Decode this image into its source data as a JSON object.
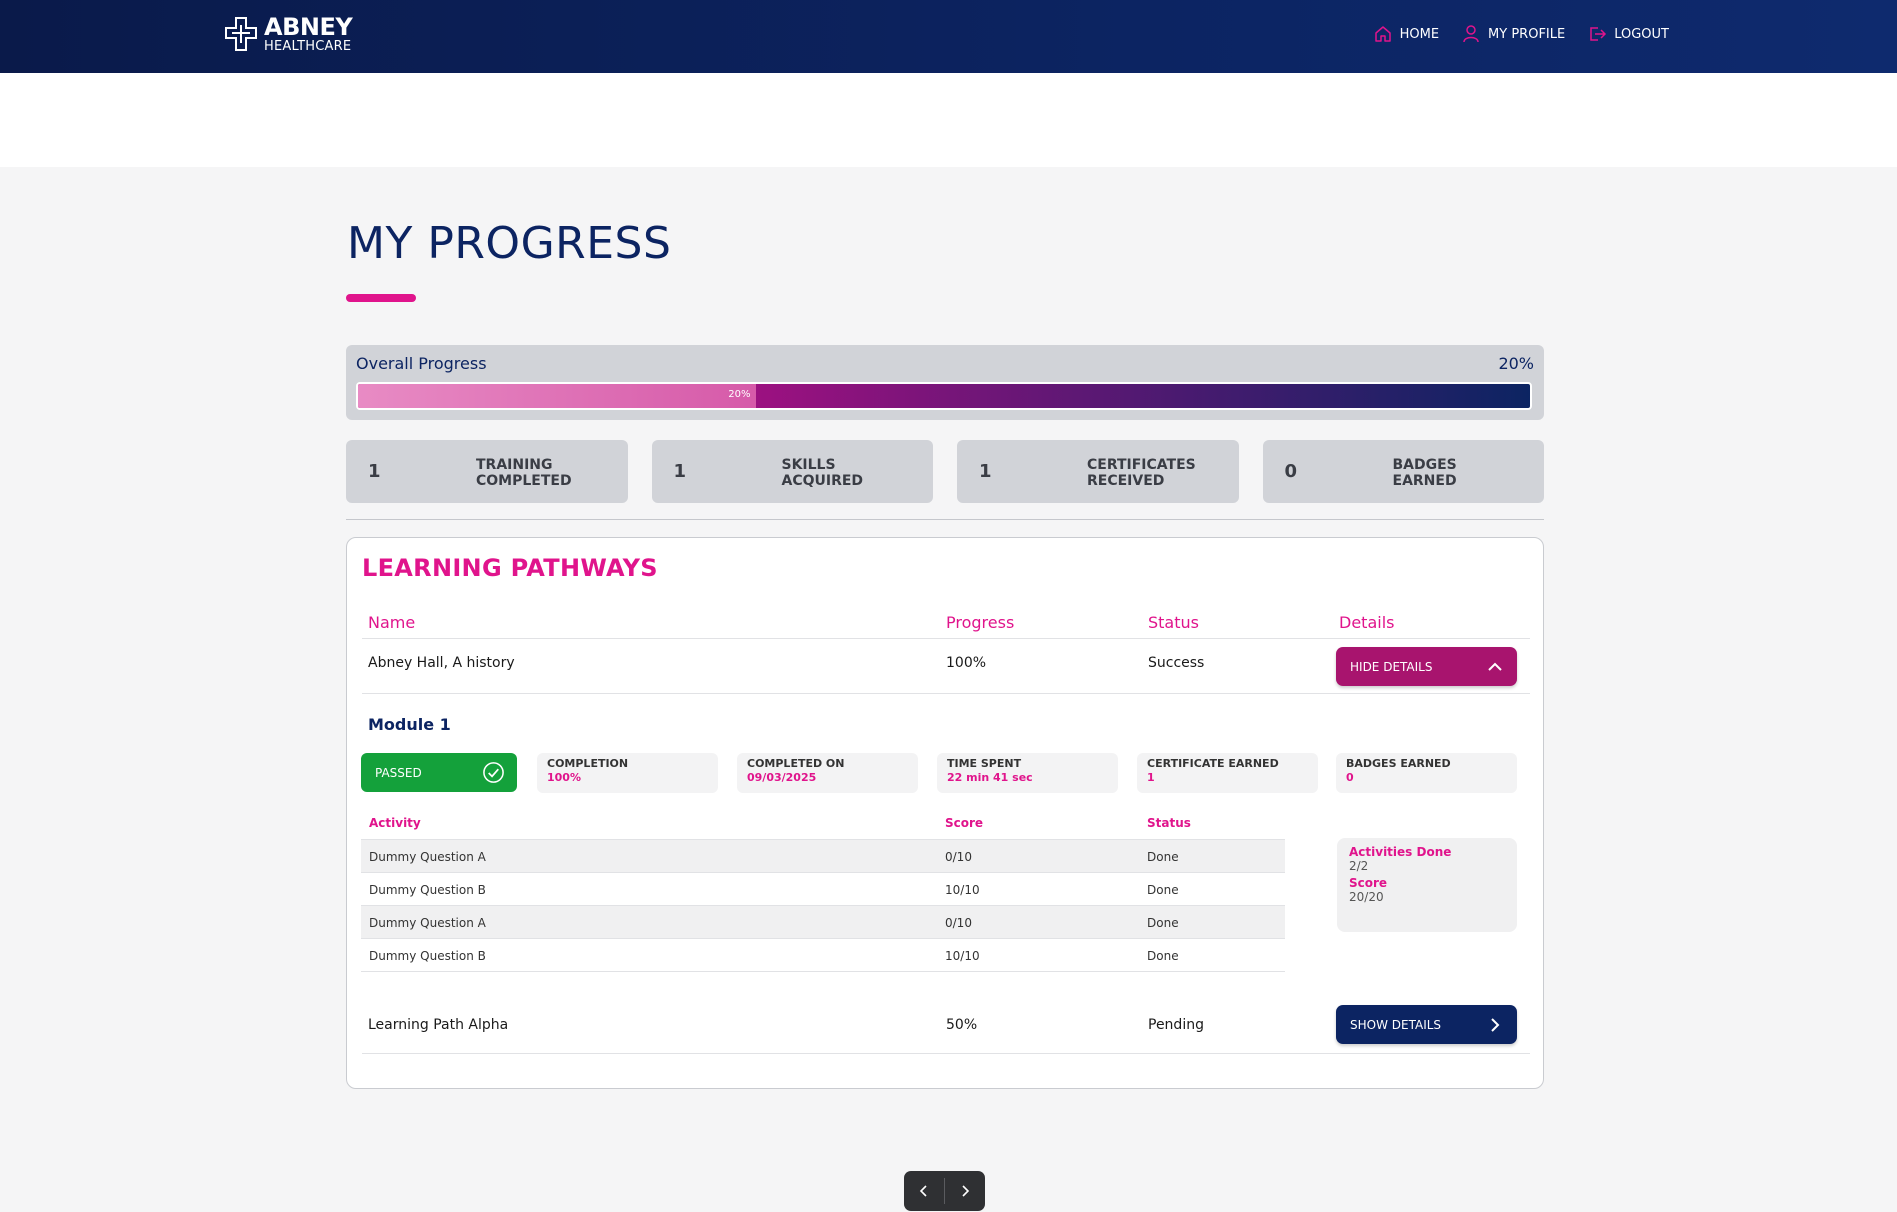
{
  "brand": {
    "name": "ABNEY",
    "sub": "HEALTHCARE"
  },
  "nav": {
    "home": "HOME",
    "profile": "MY PROFILE",
    "logout": "LOGOUT"
  },
  "page": {
    "title": "MY PROGRESS"
  },
  "overall": {
    "label": "Overall Progress",
    "percent_text": "20%",
    "bar_label": "20%",
    "value": 0.2
  },
  "stats": [
    {
      "num": "1",
      "label": "TRAINING\nCOMPLETED"
    },
    {
      "num": "1",
      "label": "SKILLS\nACQUIRED"
    },
    {
      "num": "1",
      "label": "CERTIFICATES\nRECEIVED"
    },
    {
      "num": "0",
      "label": "BADGES\nEARNED"
    }
  ],
  "pathways": {
    "title": "LEARNING PATHWAYS",
    "headers": {
      "name": "Name",
      "progress": "Progress",
      "status": "Status",
      "details": "Details"
    },
    "rows": [
      {
        "name": "Abney Hall, A history",
        "progress": "100%",
        "status": "Success",
        "button": "HIDE DETAILS"
      },
      {
        "name": "Learning Path Alpha",
        "progress": "50%",
        "status": "Pending",
        "button": "SHOW DETAILS"
      }
    ],
    "module": {
      "title": "Module 1",
      "passed": "PASSED",
      "info": [
        {
          "label": "COMPLETION",
          "value": "100%"
        },
        {
          "label": "COMPLETED ON",
          "value": "09/03/2025"
        },
        {
          "label": "TIME SPENT",
          "value": "22 min 41 sec"
        },
        {
          "label": "CERTIFICATE EARNED",
          "value": "1"
        },
        {
          "label": "BADGES EARNED",
          "value": "0"
        }
      ],
      "activity_headers": {
        "activity": "Activity",
        "score": "Score",
        "status": "Status"
      },
      "activities": [
        {
          "activity": "Dummy Question A",
          "score": "0/10",
          "status": "Done"
        },
        {
          "activity": "Dummy Question B",
          "score": "10/10",
          "status": "Done"
        },
        {
          "activity": "Dummy Question A",
          "score": "0/10",
          "status": "Done"
        },
        {
          "activity": "Dummy Question B",
          "score": "10/10",
          "status": "Done"
        }
      ],
      "summary": {
        "done_label": "Activities Done",
        "done_value": "2/2",
        "score_label": "Score",
        "score_value": "20/20"
      }
    }
  },
  "colors": {
    "navy": "#0c2462",
    "pink": "#e0148c",
    "green": "#14a13b"
  }
}
